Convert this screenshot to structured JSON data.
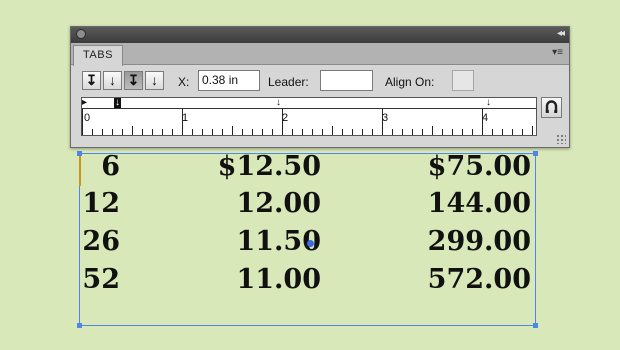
{
  "table": {
    "rows": [
      {
        "qty": "6",
        "price": "$12.50",
        "total": "$75.00"
      },
      {
        "qty": "12",
        "price": "12.00",
        "total": "144.00"
      },
      {
        "qty": "26",
        "price": "11.50",
        "total": "299.00"
      },
      {
        "qty": "52",
        "price": "11.00",
        "total": "572.00"
      }
    ]
  },
  "panel": {
    "tab_label": "TABS",
    "collapse_glyph": "◂◂",
    "menu_glyph": "▾≡",
    "tab_buttons": [
      {
        "glyph": "↧",
        "name": "left-justified-tab-icon"
      },
      {
        "glyph": "↓",
        "name": "center-justified-tab-icon"
      },
      {
        "glyph": "↧",
        "name": "right-justified-tab-icon"
      },
      {
        "glyph": "↓",
        "name": "decimal-justified-tab-icon"
      }
    ],
    "x_label": "X:",
    "x_value": "0.38 in",
    "leader_label": "Leader:",
    "leader_value": "",
    "align_on_label": "Align On:",
    "align_on_value": "",
    "ruler_numbers": [
      "0",
      "1",
      "2",
      "3",
      "4"
    ]
  },
  "colors": {
    "background": "#d8e8b8",
    "frame": "#4f86e8",
    "caret": "#c8961e"
  }
}
